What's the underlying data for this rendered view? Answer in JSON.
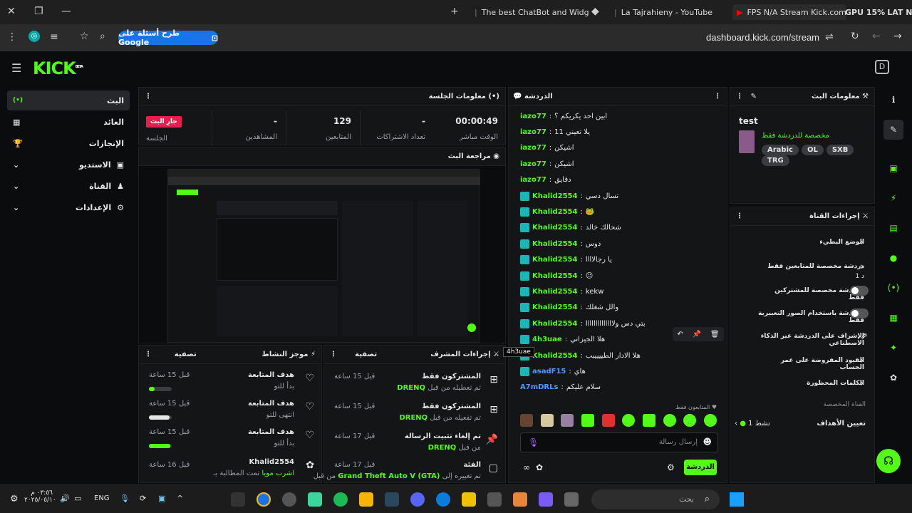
{
  "browser": {
    "tabs": [
      {
        "title": "The best ChatBot and Widgets"
      },
      {
        "title": "La Tajrahieny - YouTube"
      },
      {
        "title": "FPS N/A  Stream Kick.com"
      }
    ],
    "gpu": "GPU 15%",
    "lat": "LAT N/A",
    "google_btn": "طرح أسئلة على Google",
    "url": "dashboard.kick.com/stream"
  },
  "kick": {
    "logo": "KICK",
    "beta": "BETA"
  },
  "sidebar": [
    {
      "label": "البث",
      "icon": "(•)"
    },
    {
      "label": "العائد",
      "icon": "▦"
    },
    {
      "label": "الإنجازات",
      "icon": "🏆"
    },
    {
      "label": "الاستديو",
      "icon": "▣"
    },
    {
      "label": "القناة",
      "icon": "♟"
    },
    {
      "label": "الإعدادات",
      "icon": "⚙"
    }
  ],
  "session": {
    "title": "معلومات الجلسة",
    "live_badge": "جارِ البث",
    "session_label": "الجلسة",
    "stats": [
      {
        "value": "00:00:49",
        "label": "الوقت مباشر"
      },
      {
        "value": "-",
        "label": "تعداد الاشتراكات"
      },
      {
        "value": "129",
        "label": "المتابعين"
      },
      {
        "value": "-",
        "label": "المشاهدين"
      }
    ]
  },
  "preview": {
    "title": "مراجعة البث"
  },
  "activity": {
    "title": "موجز النشاط",
    "filter": "تصفية",
    "items": [
      {
        "title": "هدف المتابعة",
        "sub": "بدأ للتو",
        "time": "قبل 15 ساعة",
        "progress": 0.25
      },
      {
        "title": "هدف المتابعة",
        "sub": "انتهى للتو",
        "time": "قبل 15 ساعة",
        "progress": 0.9
      },
      {
        "title": "هدف المتابعة",
        "sub": "بدأ للتو",
        "time": "قبل 15 ساعة",
        "progress": 0.95
      },
      {
        "title": "Khalid2554",
        "sub": "تمت المطالبة بـ",
        "sub2": "اشرب مويا",
        "time": "قبل 16 ساعة"
      }
    ]
  },
  "modactions": {
    "title": "إجراءات المشرف",
    "filter": "تصفية",
    "items": [
      {
        "title": "المشتركون فقط",
        "sub": "تم تعطيله من قبل",
        "who": "DRENQ",
        "time": "قبل 15 ساعة"
      },
      {
        "title": "المشتركون فقط",
        "sub": "تم تفعيله من قبل",
        "who": "DRENQ",
        "time": "قبل 15 ساعة"
      },
      {
        "title": "تم إلغاء تثبيت الرسالة",
        "sub": "من قبل",
        "who": "DRENQ",
        "time": "قبل 17 ساعة"
      },
      {
        "title": "الفئة",
        "sub": "تم تغييره إلى",
        "who": "Grand Theft Auto V (GTA)",
        "sub2": "من قبل",
        "time": "قبل 17 ساعة"
      }
    ]
  },
  "chat": {
    "title": "الدردشة",
    "followers_only": "المتابعون فقط",
    "placeholder": "إرسال رسالة",
    "send": "الدردشة",
    "tooltip": "4h3uae",
    "messages": [
      {
        "user": "iazo77",
        "text": "ابين احد يكريكم ؟",
        "color": "#53fc18",
        "badge": false
      },
      {
        "user": "iazo77",
        "text": "يلا تعيني 11",
        "color": "#53fc18",
        "badge": false
      },
      {
        "user": "iazo77",
        "text": "اشيكن",
        "color": "#53fc18",
        "badge": false
      },
      {
        "user": "iazo77",
        "text": "اشيكن",
        "color": "#53fc18",
        "badge": false
      },
      {
        "user": "iazo77",
        "text": "دقايق",
        "color": "#53fc18",
        "badge": false
      },
      {
        "user": "Khalid2554",
        "text": "تسال دسي",
        "color": "#53fc18",
        "badge": true
      },
      {
        "user": "Khalid2554",
        "text": "🐸",
        "color": "#53fc18",
        "badge": true
      },
      {
        "user": "Khalid2554",
        "text": "شحالك خالد",
        "color": "#53fc18",
        "badge": true
      },
      {
        "user": "Khalid2554",
        "text": "دوس",
        "color": "#53fc18",
        "badge": true
      },
      {
        "user": "Khalid2554",
        "text": "يا رجالاااا",
        "color": "#53fc18",
        "badge": true
      },
      {
        "user": "Khalid2554",
        "text": "😐",
        "color": "#53fc18",
        "badge": true
      },
      {
        "user": "Khalid2554",
        "text": "kekw",
        "color": "#53fc18",
        "badge": true
      },
      {
        "user": "Khalid2554",
        "text": "والل شغلك",
        "color": "#53fc18",
        "badge": true
      },
      {
        "user": "Khalid2554",
        "text": "بتي دس ولاااااااااااااا",
        "color": "#53fc18",
        "badge": true
      },
      {
        "user": "4h3uae",
        "text": "هلا الجيزاني",
        "color": "#53fc18",
        "badge": true
      },
      {
        "user": "Khalid2554",
        "text": "هلا الادار الطييييبب",
        "color": "#53fc18",
        "badge": true
      },
      {
        "user": "asadF15",
        "text": "هاي",
        "color": "#4a9cff",
        "badge": true
      },
      {
        "user": "A7mDRLs",
        "text": "سلام عليكم",
        "color": "#4a9cff",
        "badge": false
      }
    ]
  },
  "streaminfo": {
    "title": "معلومات البث",
    "stream_title": "test",
    "sub": "مخصصة للدردشة فقط",
    "tags": [
      "Arabic",
      "OL",
      "SXB",
      "TRG"
    ]
  },
  "channelactions": {
    "title": "إجراءات القناة",
    "items": [
      {
        "label": "الوضع البطيء",
        "type": "arrow"
      },
      {
        "label": "دردشة مخصصة للمتابعين فقط",
        "sub": "1 د",
        "type": "arrow"
      },
      {
        "label": "الدردشة مخصصة للمشتركين فقط",
        "type": "toggle"
      },
      {
        "label": "الدردشة باستخدام الصور التعبيرية فقط",
        "type": "toggle"
      },
      {
        "label": "الإشراف على الدردشة عبر الذكاء الاصطناعي",
        "type": "ext"
      },
      {
        "label": "القيود المفروضة على عمر الحساب",
        "type": "arrow"
      },
      {
        "label": "الكلمات المحظورة",
        "type": "arrow"
      }
    ],
    "section": "القناة المخصصة",
    "goal_label": "تعيين الأهداف",
    "goal_status": "نشط 1"
  },
  "taskbar": {
    "time": "٠٣:٥٦ م",
    "date": "٢٠٢٥/٠٥/١٠",
    "lang": "ENG",
    "search": "بحث"
  }
}
